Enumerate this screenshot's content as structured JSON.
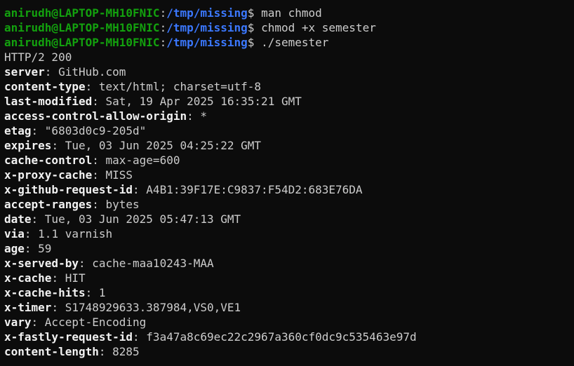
{
  "prompt": {
    "user_host": "anirudh@LAPTOP-MH10FNIC",
    "separator": ":",
    "path": "/tmp/missing",
    "symbol": "$"
  },
  "commands": [
    "man chmod",
    "chmod +x semester",
    "./semester"
  ],
  "status_line": "HTTP/2 200",
  "headers": [
    {
      "key": "server",
      "value": "GitHub.com"
    },
    {
      "key": "content-type",
      "value": "text/html; charset=utf-8"
    },
    {
      "key": "last-modified",
      "value": "Sat, 19 Apr 2025 16:35:21 GMT"
    },
    {
      "key": "access-control-allow-origin",
      "value": "*"
    },
    {
      "key": "etag",
      "value": "\"6803d0c9-205d\""
    },
    {
      "key": "expires",
      "value": "Tue, 03 Jun 2025 04:25:22 GMT"
    },
    {
      "key": "cache-control",
      "value": "max-age=600"
    },
    {
      "key": "x-proxy-cache",
      "value": "MISS"
    },
    {
      "key": "x-github-request-id",
      "value": "A4B1:39F17E:C9837:F54D2:683E76DA"
    },
    {
      "key": "accept-ranges",
      "value": "bytes"
    },
    {
      "key": "date",
      "value": "Tue, 03 Jun 2025 05:47:13 GMT"
    },
    {
      "key": "via",
      "value": "1.1 varnish"
    },
    {
      "key": "age",
      "value": "59"
    },
    {
      "key": "x-served-by",
      "value": "cache-maa10243-MAA"
    },
    {
      "key": "x-cache",
      "value": "HIT"
    },
    {
      "key": "x-cache-hits",
      "value": "1"
    },
    {
      "key": "x-timer",
      "value": "S1748929633.387984,VS0,VE1"
    },
    {
      "key": "vary",
      "value": "Accept-Encoding"
    },
    {
      "key": "x-fastly-request-id",
      "value": "f3a47a8c69ec22c2967a360cf0dc9c535463e97d"
    },
    {
      "key": "content-length",
      "value": "8285"
    }
  ],
  "colors": {
    "background": "#0c0c0c",
    "user_host": "#13a10e",
    "path": "#3b78ff",
    "text": "#cccccc",
    "header_key": "#f2f2f2"
  }
}
